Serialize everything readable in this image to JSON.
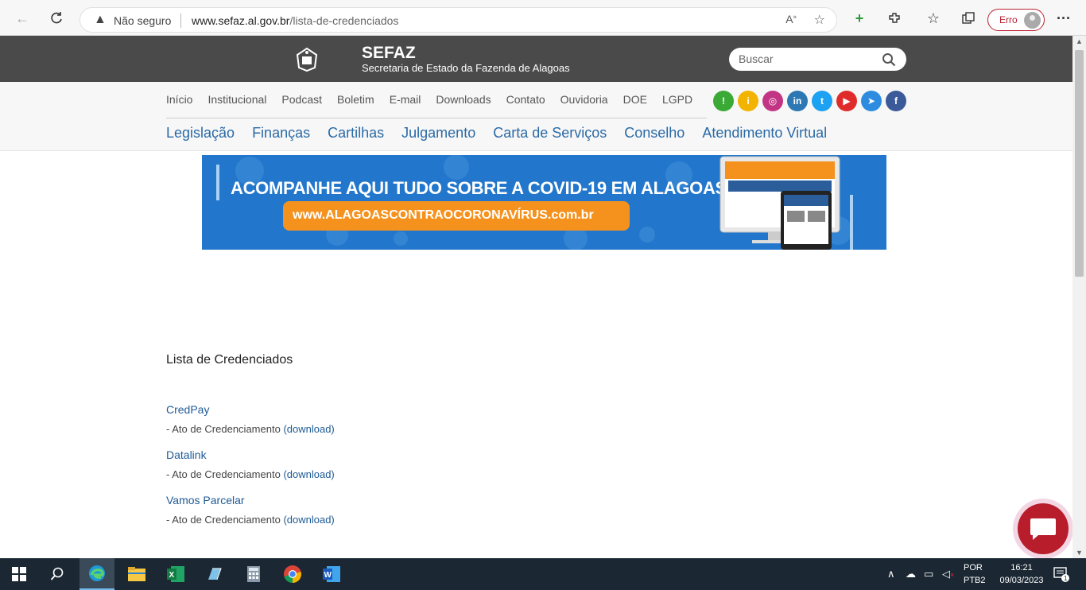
{
  "browser": {
    "security_label": "Não seguro",
    "url_domain": "www.sefaz.al.gov.br",
    "url_path": "/lista-de-credenciados",
    "profile_label": "Erro"
  },
  "header": {
    "brand_name": "SEFAZ",
    "brand_subtitle": "Secretaria de Estado da Fazenda de Alagoas",
    "search_placeholder": "Buscar"
  },
  "top_nav": [
    "Início",
    "Institucional",
    "Podcast",
    "Boletim",
    "E-mail",
    "Downloads",
    "Contato",
    "Ouvidoria",
    "DOE",
    "LGPD"
  ],
  "social": [
    {
      "name": "ouvidoria-icon",
      "glyph": "!",
      "color": "#3aa935"
    },
    {
      "name": "info-icon",
      "glyph": "i",
      "color": "#f2b400"
    },
    {
      "name": "instagram-icon",
      "glyph": "◎",
      "color": "#c13584"
    },
    {
      "name": "linkedin-icon",
      "glyph": "in",
      "color": "#2d77b4"
    },
    {
      "name": "twitter-icon",
      "glyph": "t",
      "color": "#1da1f2"
    },
    {
      "name": "youtube-icon",
      "glyph": "▶",
      "color": "#e02b2b"
    },
    {
      "name": "telegram-icon",
      "glyph": "➤",
      "color": "#2e8ce0"
    },
    {
      "name": "facebook-icon",
      "glyph": "f",
      "color": "#3b5a9a"
    }
  ],
  "main_nav": [
    "Legislação",
    "Finanças",
    "Cartilhas",
    "Julgamento",
    "Carta de Serviços",
    "Conselho",
    "Atendimento Virtual"
  ],
  "banner": {
    "headline": "ACOMPANHE AQUI TUDO SOBRE A COVID-19 EM ALAGOAS",
    "url": "www.ALAGOASCONTRAOCORONAVÍRUS.com.br"
  },
  "content": {
    "title": "Lista de Credenciados",
    "items": [
      {
        "name": "CredPay",
        "desc": "- Ato de Credenciamento",
        "link": "(download)"
      },
      {
        "name": "Datalink",
        "desc": "- Ato de Credenciamento",
        "link": "(download)"
      },
      {
        "name": "Vamos Parcelar",
        "desc": "- Ato de Credenciamento",
        "link": "(download)"
      }
    ]
  },
  "taskbar": {
    "lang_primary": "POR",
    "lang_secondary": "PTB2",
    "time": "16:21",
    "date": "09/03/2023",
    "notification_count": "1"
  }
}
